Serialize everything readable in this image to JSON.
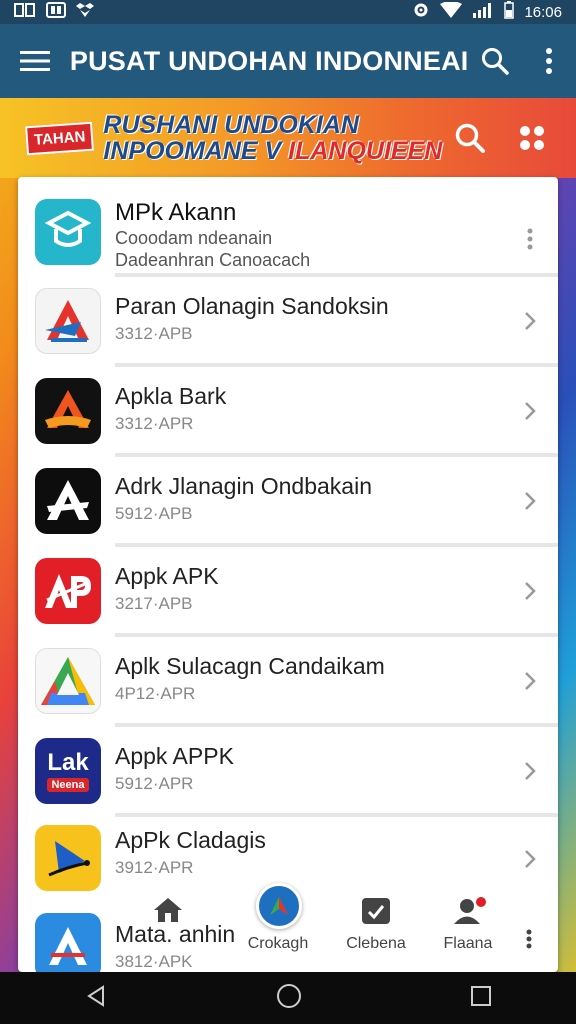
{
  "status_bar": {
    "left_icons": [
      "sim-icon",
      "notification-icon",
      "dropbox-icon"
    ],
    "time": "16:06"
  },
  "app_bar": {
    "title": "PUSAT UNDOHAN INDONNEAI"
  },
  "banner": {
    "badge": "TAHAN",
    "line1": "RUSHANI UNDOKIAN",
    "line2_a": "INPOOMANE V ",
    "line2_b": "ILANQUIEEN"
  },
  "featured": {
    "name": "MPk Akann",
    "sub1": "Cooodam ndeanain",
    "sub2": "Dadeanhran Canoacach"
  },
  "apps": [
    {
      "name": "Paran Olanagin Sandoksin",
      "meta": "3312·APB"
    },
    {
      "name": "Apkla Bark",
      "meta": "3312·APR"
    },
    {
      "name": "Adrk Jlanagin Ondbakain",
      "meta": "5912·APB"
    },
    {
      "name": "Appk APK",
      "meta": "3217·APB"
    },
    {
      "name": "Aplk Sulacagn Candaikam",
      "meta": "4P12·APR"
    },
    {
      "name": "Appk APPK",
      "meta": "5912·APR"
    },
    {
      "name": "ApPk Cladagis",
      "meta": "3912·APR"
    },
    {
      "name": "Mata. anhin",
      "meta": "3812·APK"
    }
  ],
  "icon_text": {
    "lak_top": "Lak",
    "lak_bottom": "Neena"
  },
  "bottom_nav": [
    {
      "label": "",
      "icon": "home-icon"
    },
    {
      "label": "Crokagh",
      "icon": "compass-icon"
    },
    {
      "label": "Clebena",
      "icon": "check-icon"
    },
    {
      "label": "Flaana",
      "icon": "user-icon"
    }
  ],
  "colors": {
    "app_bar": "#24597e",
    "status_bar": "#1f4563",
    "banner_text": "#1f4a8a",
    "banner_highlight": "#e02a2a"
  }
}
